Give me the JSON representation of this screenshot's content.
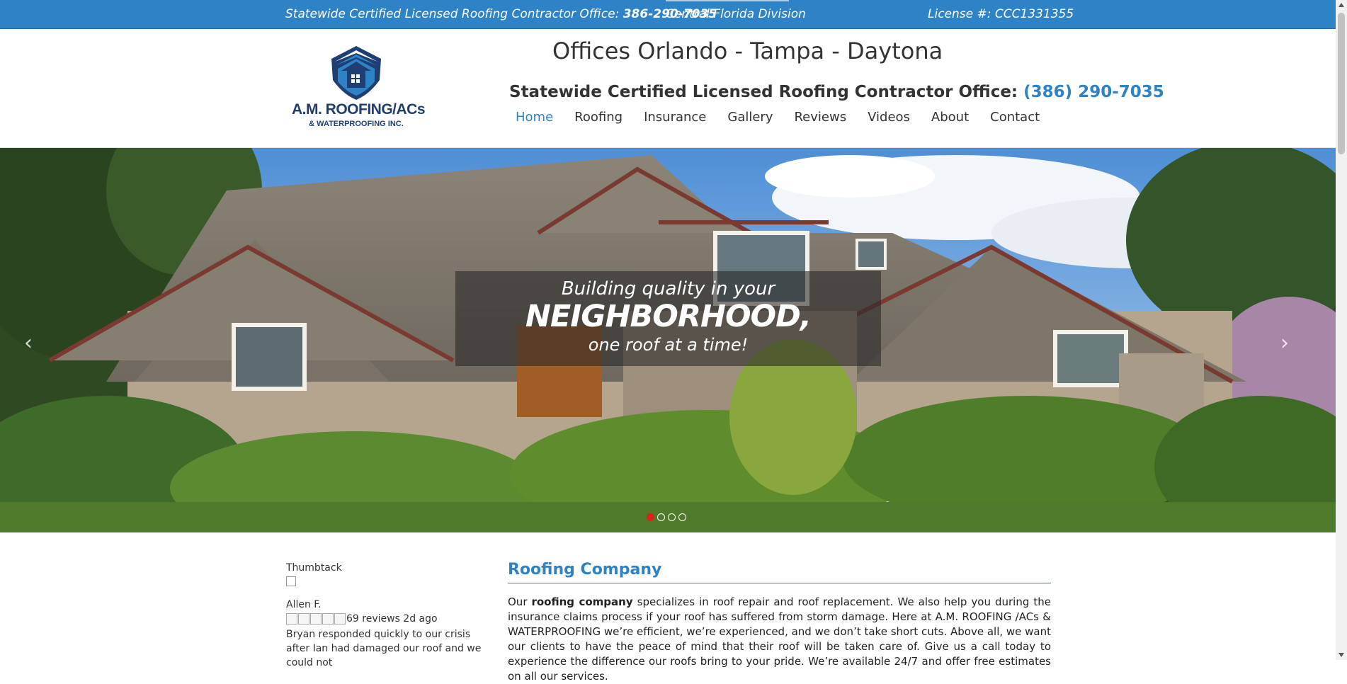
{
  "topbar": {
    "certified_prefix": "Statewide Certified Licensed Roofing Contractor Office:",
    "phone": "386-290-7035",
    "division": "Central Florida Division",
    "license": "License #: CCC1331355"
  },
  "logo": {
    "line1": "A.M. ROOFING/ACs",
    "line2": "& WATERPROOFING INC."
  },
  "header": {
    "offices": "Offices Orlando - Tampa - Daytona",
    "phone_prefix": "Statewide Certified Licensed Roofing Contractor Office:",
    "phone": "(386) 290-7035"
  },
  "nav": {
    "items": [
      "Home",
      "Roofing",
      "Insurance",
      "Gallery",
      "Reviews",
      "Videos",
      "About",
      "Contact"
    ]
  },
  "hero": {
    "line1": "Building quality in your",
    "line2": "NEIGHBORHOOD,",
    "line3": "one roof at a time!",
    "active_slide": 1,
    "slide_count": 4
  },
  "sidebar": {
    "thumbtack_alt": "Thumbtack",
    "reviewer": "Allen F.",
    "review_meta": "69 reviews 2d ago",
    "review_text": "Bryan responded quickly to our crisis after Ian had damaged our roof and we could not"
  },
  "main": {
    "heading": "Roofing Company",
    "p_lead": "Our ",
    "p_bold": "roofing company",
    "p_rest": " specializes in roof repair and roof replacement. We also help you during the insurance claims process if your roof has suffered from storm damage. Here at A.M. ROOFING /ACs & WATERPROOFING we’re efficient, we’re experienced, and we don’t take short cuts. Above all, we want our clients to have the peace of mind that their roof will be taken care of. Give us a call today to experience the difference our roofs bring to your  pride. We’re available 24/7 and offer free estimates on all our services."
  },
  "colors": {
    "brand_blue": "#2e82c6",
    "logo_navy": "#1f3f73",
    "active_dot": "#e0201b"
  }
}
